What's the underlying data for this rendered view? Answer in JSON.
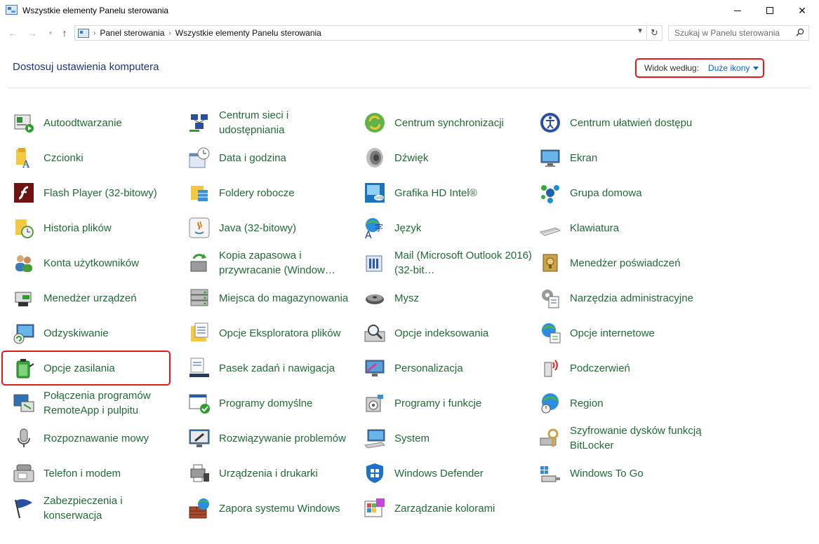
{
  "window": {
    "title": "Wszystkie elementy Panelu sterowania"
  },
  "nav": {
    "breadcrumb": [
      "Panel sterowania",
      "Wszystkie elementy Panelu sterowania"
    ],
    "search_placeholder": "Szukaj w Panelu sterowania"
  },
  "header": {
    "title": "Dostosuj ustawienia komputera",
    "view_by_label": "Widok według:",
    "view_by_value": "Duże ikony"
  },
  "items": [
    [
      "Autoodtwarzanie",
      "Centrum sieci i udostępniania",
      "Centrum synchronizacji",
      "Centrum ułatwień dostępu"
    ],
    [
      "Czcionki",
      "Data i godzina",
      "Dźwięk",
      "Ekran"
    ],
    [
      "Flash Player (32-bitowy)",
      "Foldery robocze",
      "Grafika HD Intel®",
      "Grupa domowa"
    ],
    [
      "Historia plików",
      "Java (32-bitowy)",
      "Język",
      "Klawiatura"
    ],
    [
      "Konta użytkowników",
      "Kopia zapasowa i przywracanie (Window…",
      "Mail (Microsoft Outlook 2016) (32-bit…",
      "Menedżer poświadczeń"
    ],
    [
      "Menedżer urządzeń",
      "Miejsca do magazynowania",
      "Mysz",
      "Narzędzia administracyjne"
    ],
    [
      "Odzyskiwanie",
      "Opcje Eksploratora plików",
      "Opcje indeksowania",
      "Opcje internetowe"
    ],
    [
      "Opcje zasilania",
      "Pasek zadań i nawigacja",
      "Personalizacja",
      "Podczerwień"
    ],
    [
      "Połączenia programów RemoteApp i pulpitu",
      "Programy domyślne",
      "Programy i funkcje",
      "Region"
    ],
    [
      "Rozpoznawanie mowy",
      "Rozwiązywanie problemów",
      "System",
      "Szyfrowanie dysków funkcją BitLocker"
    ],
    [
      "Telefon i modem",
      "Urządzenia i drukarki",
      "Windows Defender",
      "Windows To Go"
    ],
    [
      "Zabezpieczenia i konserwacja",
      "Zapora systemu Windows",
      "Zarządzanie kolorami",
      ""
    ]
  ],
  "colors": {
    "item_text": "#1f6b36",
    "title_text": "#1e3287",
    "link": "#0066cc",
    "highlight": "#e8151b"
  }
}
